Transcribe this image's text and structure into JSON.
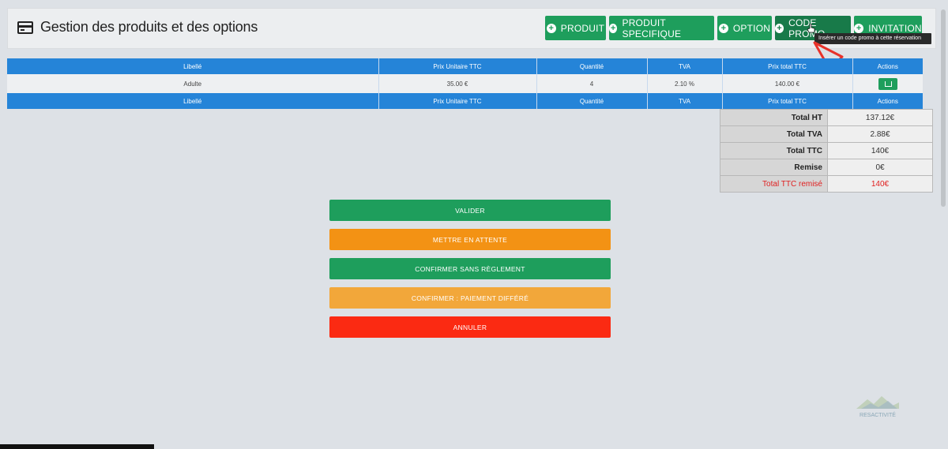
{
  "header": {
    "title": "Gestion des produits et des options",
    "buttons": [
      {
        "label": "PRODUIT"
      },
      {
        "label": "PRODUIT SPECIFIQUE"
      },
      {
        "label": "OPTION"
      },
      {
        "label": "CODE PROMO"
      },
      {
        "label": "INVITATION"
      }
    ],
    "tooltip": "Insérer un code promo à cette réservation"
  },
  "table": {
    "columns": [
      "Libellé",
      "Prix Unitaire TTC",
      "Quantité",
      "TVA",
      "Prix total TTC",
      "Actions"
    ],
    "rows": [
      [
        "Adulte",
        "35.00 €",
        "4",
        "2.10 %",
        "140.00 €"
      ]
    ]
  },
  "totals": [
    {
      "label": "Total HT",
      "value": "137.12€"
    },
    {
      "label": "Total TVA",
      "value": "2.88€"
    },
    {
      "label": "Total TTC",
      "value": "140€"
    },
    {
      "label": "Remise",
      "value": "0€"
    },
    {
      "label": "Total TTC remisé",
      "value": "140€"
    }
  ],
  "actions": {
    "validate": "VALIDER",
    "hold": "METTRE EN ATTENTE",
    "confirm_no_payment": "CONFIRMER SANS RÈGLEMENT",
    "confirm_deferred": "CONFIRMER : PAIEMENT DIFFÉRÉ",
    "cancel": "ANNULER"
  },
  "colors": {
    "green": "#1e9e5c",
    "orange": "#f39214",
    "light_orange": "#f2a73a",
    "red": "#fb2a12",
    "blue": "#2584d8",
    "arrow": "#e8322a"
  },
  "logo": {
    "text": "RESACTIVITÉ"
  }
}
